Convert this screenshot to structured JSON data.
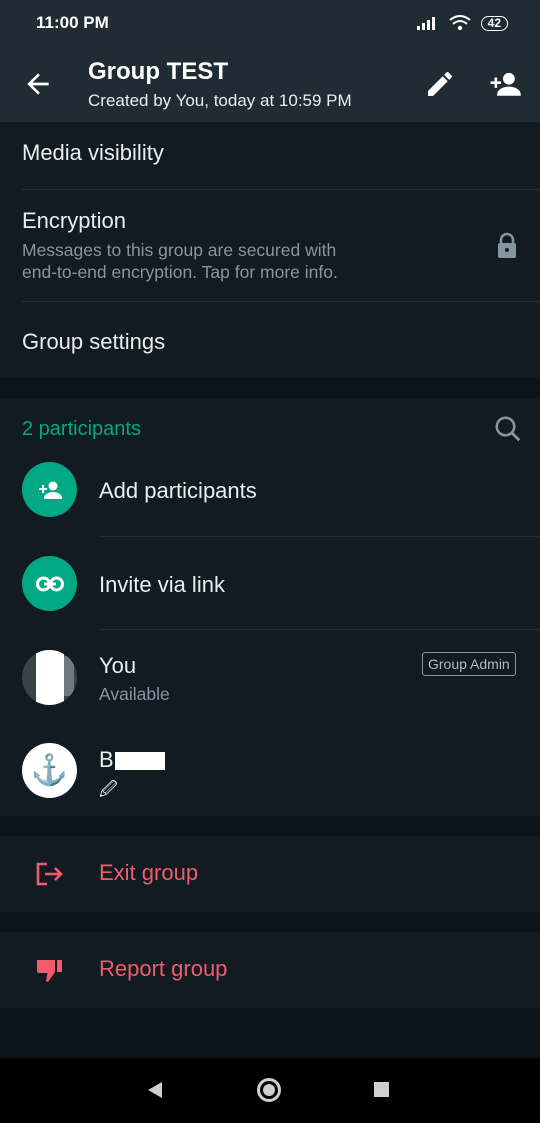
{
  "status": {
    "time": "11:00 PM",
    "battery": "42"
  },
  "header": {
    "title": "Group TEST",
    "subtitle": "Created by You, today at 10:59 PM",
    "back_icon": "arrow-left-icon",
    "edit_icon": "pencil-icon",
    "add_participant_icon": "person-add-icon"
  },
  "settings": {
    "media_visibility": "Media visibility",
    "encryption_title": "Encryption",
    "encryption_desc_line1": "Messages to this group are secured with",
    "encryption_desc_line2": "end-to-end encryption. Tap for more info.",
    "group_settings": "Group settings"
  },
  "participants": {
    "count_label": "2 participants",
    "add_label": "Add participants",
    "invite_label": "Invite via link",
    "members": [
      {
        "name": "You",
        "about": "Available",
        "badge": "Group Admin"
      },
      {
        "name": "B",
        "about": "🖉"
      }
    ]
  },
  "actions": {
    "exit_label": "Exit group",
    "report_label": "Report group"
  },
  "colors": {
    "accent": "#00a884",
    "danger": "#f15c6d",
    "background": "#0b141a",
    "surface": "#111b21"
  }
}
